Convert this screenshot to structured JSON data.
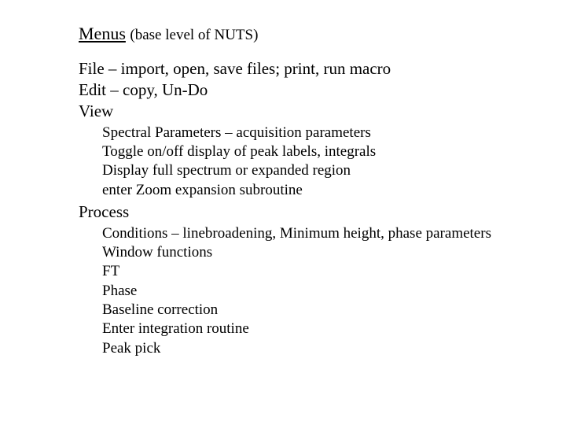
{
  "title": {
    "main": "Menus",
    "paren": "(base level of NUTS)"
  },
  "file_line": "File – import, open, save files; print, run macro",
  "edit_line": "Edit – copy, Un-Do",
  "view_label": "View",
  "view_items": {
    "0": "Spectral Parameters – acquisition parameters",
    "1": "Toggle on/off display of peak labels, integrals",
    "2": "Display full spectrum or expanded region",
    "3": "enter Zoom expansion subroutine"
  },
  "process_label": "Process",
  "process_items": {
    "0": "Conditions – linebroadening, Minimum height, phase parameters",
    "1": "Window functions",
    "2": "FT",
    "3": "Phase",
    "4": "Baseline correction",
    "5": "Enter integration routine",
    "6": "Peak pick"
  }
}
